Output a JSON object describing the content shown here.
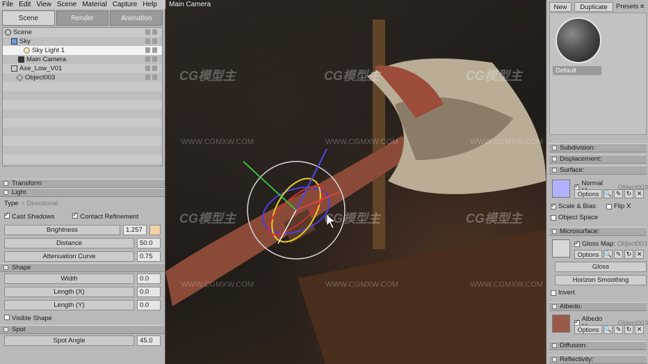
{
  "menu": [
    "File",
    "Edit",
    "View",
    "Scene",
    "Material",
    "Capture",
    "Help"
  ],
  "tabs": [
    "Scene",
    "Render",
    "Animation"
  ],
  "scene_tree": [
    {
      "label": "Scene",
      "indent": 0
    },
    {
      "label": "Sky",
      "indent": 1
    },
    {
      "label": "Sky Light 1",
      "indent": 2
    },
    {
      "label": "Main Camera",
      "indent": 1
    },
    {
      "label": "Axe_Low_V01",
      "indent": 1
    },
    {
      "label": "Object003",
      "indent": 2
    }
  ],
  "sections": {
    "transform": "Transform",
    "light": "Light",
    "shape": "Shape",
    "spot": "Spot"
  },
  "light": {
    "type_label": "Type",
    "type_value": "Directional",
    "cast_shadows": "Cast Shadows",
    "contact_refinement": "Contact Refinement",
    "brightness_label": "Brightness",
    "brightness_value": "1.257",
    "distance_label": "Distance",
    "distance_value": "50.0",
    "attenuation_label": "Attenuation Curve",
    "attenuation_value": "0.75"
  },
  "shape": {
    "width_label": "Width",
    "width_value": "0.0",
    "lengthx_label": "Length (X)",
    "lengthx_value": "0.0",
    "lengthy_label": "Length (Y)",
    "lengthy_value": "0.0",
    "visible_shape": "Visible Shape"
  },
  "spot": {
    "angle_label": "Spot Angle",
    "angle_value": "45.0"
  },
  "viewport": {
    "title": "Main Camera",
    "watermark_logo": "CG模型主",
    "watermark_url": "WWW.CGMXW.COM"
  },
  "right": {
    "new_label": "New",
    "duplicate_label": "Duplicate",
    "presets_label": "Presets",
    "material_name": "Default",
    "subdivision": "Subdivision:",
    "displacement": "Displacement:",
    "surface": "Surface:",
    "normal_map": "Normal Map:",
    "normal_map_obj": "Object003",
    "options": "Options",
    "scale_bias": "Scale & Bias",
    "flip_x": "Flip X",
    "object_space": "Object Space",
    "microsurface": "Microsurface:",
    "gloss_map": "Gloss Map:",
    "gloss_map_obj": "Object003",
    "gloss": "Gloss",
    "horizon_smoothing": "Horizon Smoothing",
    "invert": "Invert",
    "albedo": "Albedo:",
    "albedo_map": "Albedo Map:",
    "albedo_map_obj": "Object003",
    "diffusion": "Diffusion:",
    "reflectivity": "Reflectivity:"
  }
}
